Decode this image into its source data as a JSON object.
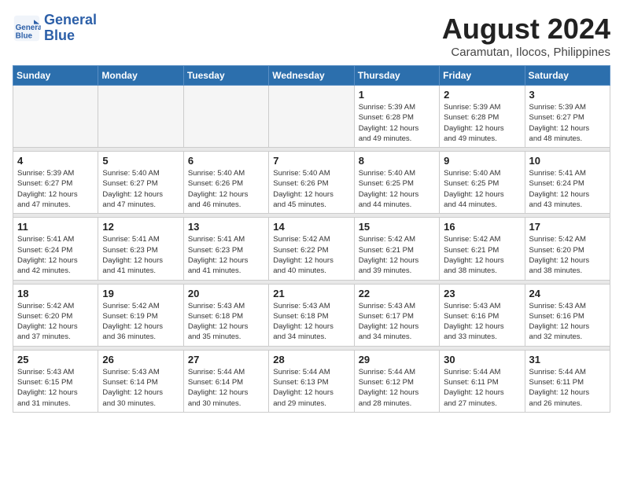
{
  "header": {
    "logo_line1": "General",
    "logo_line2": "Blue",
    "month_year": "August 2024",
    "location": "Caramutan, Ilocos, Philippines"
  },
  "weekdays": [
    "Sunday",
    "Monday",
    "Tuesday",
    "Wednesday",
    "Thursday",
    "Friday",
    "Saturday"
  ],
  "weeks": [
    [
      {
        "day": "",
        "info": ""
      },
      {
        "day": "",
        "info": ""
      },
      {
        "day": "",
        "info": ""
      },
      {
        "day": "",
        "info": ""
      },
      {
        "day": "1",
        "info": "Sunrise: 5:39 AM\nSunset: 6:28 PM\nDaylight: 12 hours\nand 49 minutes."
      },
      {
        "day": "2",
        "info": "Sunrise: 5:39 AM\nSunset: 6:28 PM\nDaylight: 12 hours\nand 49 minutes."
      },
      {
        "day": "3",
        "info": "Sunrise: 5:39 AM\nSunset: 6:27 PM\nDaylight: 12 hours\nand 48 minutes."
      }
    ],
    [
      {
        "day": "4",
        "info": "Sunrise: 5:39 AM\nSunset: 6:27 PM\nDaylight: 12 hours\nand 47 minutes."
      },
      {
        "day": "5",
        "info": "Sunrise: 5:40 AM\nSunset: 6:27 PM\nDaylight: 12 hours\nand 47 minutes."
      },
      {
        "day": "6",
        "info": "Sunrise: 5:40 AM\nSunset: 6:26 PM\nDaylight: 12 hours\nand 46 minutes."
      },
      {
        "day": "7",
        "info": "Sunrise: 5:40 AM\nSunset: 6:26 PM\nDaylight: 12 hours\nand 45 minutes."
      },
      {
        "day": "8",
        "info": "Sunrise: 5:40 AM\nSunset: 6:25 PM\nDaylight: 12 hours\nand 44 minutes."
      },
      {
        "day": "9",
        "info": "Sunrise: 5:40 AM\nSunset: 6:25 PM\nDaylight: 12 hours\nand 44 minutes."
      },
      {
        "day": "10",
        "info": "Sunrise: 5:41 AM\nSunset: 6:24 PM\nDaylight: 12 hours\nand 43 minutes."
      }
    ],
    [
      {
        "day": "11",
        "info": "Sunrise: 5:41 AM\nSunset: 6:24 PM\nDaylight: 12 hours\nand 42 minutes."
      },
      {
        "day": "12",
        "info": "Sunrise: 5:41 AM\nSunset: 6:23 PM\nDaylight: 12 hours\nand 41 minutes."
      },
      {
        "day": "13",
        "info": "Sunrise: 5:41 AM\nSunset: 6:23 PM\nDaylight: 12 hours\nand 41 minutes."
      },
      {
        "day": "14",
        "info": "Sunrise: 5:42 AM\nSunset: 6:22 PM\nDaylight: 12 hours\nand 40 minutes."
      },
      {
        "day": "15",
        "info": "Sunrise: 5:42 AM\nSunset: 6:21 PM\nDaylight: 12 hours\nand 39 minutes."
      },
      {
        "day": "16",
        "info": "Sunrise: 5:42 AM\nSunset: 6:21 PM\nDaylight: 12 hours\nand 38 minutes."
      },
      {
        "day": "17",
        "info": "Sunrise: 5:42 AM\nSunset: 6:20 PM\nDaylight: 12 hours\nand 38 minutes."
      }
    ],
    [
      {
        "day": "18",
        "info": "Sunrise: 5:42 AM\nSunset: 6:20 PM\nDaylight: 12 hours\nand 37 minutes."
      },
      {
        "day": "19",
        "info": "Sunrise: 5:42 AM\nSunset: 6:19 PM\nDaylight: 12 hours\nand 36 minutes."
      },
      {
        "day": "20",
        "info": "Sunrise: 5:43 AM\nSunset: 6:18 PM\nDaylight: 12 hours\nand 35 minutes."
      },
      {
        "day": "21",
        "info": "Sunrise: 5:43 AM\nSunset: 6:18 PM\nDaylight: 12 hours\nand 34 minutes."
      },
      {
        "day": "22",
        "info": "Sunrise: 5:43 AM\nSunset: 6:17 PM\nDaylight: 12 hours\nand 34 minutes."
      },
      {
        "day": "23",
        "info": "Sunrise: 5:43 AM\nSunset: 6:16 PM\nDaylight: 12 hours\nand 33 minutes."
      },
      {
        "day": "24",
        "info": "Sunrise: 5:43 AM\nSunset: 6:16 PM\nDaylight: 12 hours\nand 32 minutes."
      }
    ],
    [
      {
        "day": "25",
        "info": "Sunrise: 5:43 AM\nSunset: 6:15 PM\nDaylight: 12 hours\nand 31 minutes."
      },
      {
        "day": "26",
        "info": "Sunrise: 5:43 AM\nSunset: 6:14 PM\nDaylight: 12 hours\nand 30 minutes."
      },
      {
        "day": "27",
        "info": "Sunrise: 5:44 AM\nSunset: 6:14 PM\nDaylight: 12 hours\nand 30 minutes."
      },
      {
        "day": "28",
        "info": "Sunrise: 5:44 AM\nSunset: 6:13 PM\nDaylight: 12 hours\nand 29 minutes."
      },
      {
        "day": "29",
        "info": "Sunrise: 5:44 AM\nSunset: 6:12 PM\nDaylight: 12 hours\nand 28 minutes."
      },
      {
        "day": "30",
        "info": "Sunrise: 5:44 AM\nSunset: 6:11 PM\nDaylight: 12 hours\nand 27 minutes."
      },
      {
        "day": "31",
        "info": "Sunrise: 5:44 AM\nSunset: 6:11 PM\nDaylight: 12 hours\nand 26 minutes."
      }
    ]
  ]
}
